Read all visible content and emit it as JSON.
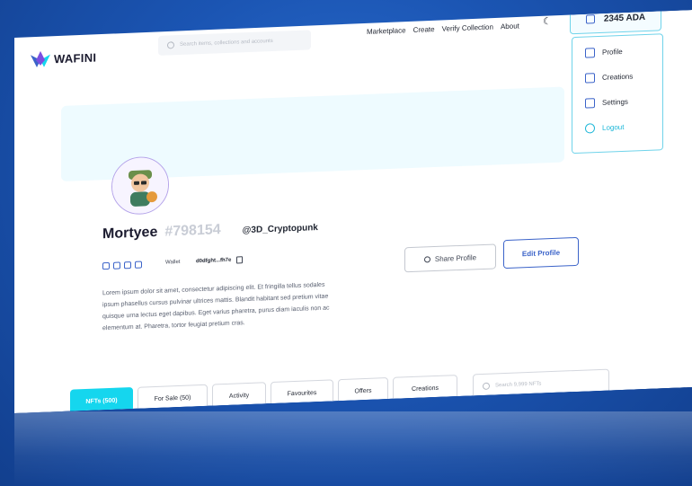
{
  "brand": {
    "logo_text": "WAFINI"
  },
  "header": {
    "search_placeholder": "Search items, collections and accounts",
    "nav": [
      "Marketplace",
      "Create",
      "Verify Collection",
      "About"
    ],
    "wallet_balance": "2345 ADA"
  },
  "dropdown": {
    "items": [
      {
        "label": "Profile",
        "icon": "profile-icon"
      },
      {
        "label": "Creations",
        "icon": "palette-icon"
      },
      {
        "label": "Settings",
        "icon": "gear-icon"
      },
      {
        "label": "Logout",
        "icon": "logout-icon"
      }
    ]
  },
  "profile": {
    "name": "Mortyee",
    "id_tag": "#798154",
    "handle": "@3D_Cryptopunk",
    "wallet_label": "Wallet",
    "wallet_address": "d0dfght...fh7e",
    "bio": "Lorem ipsum dolor sit amet, consectetur adipiscing elit. Et fringilla tellus sodales ipsum phasellus cursus pulvinar ultrices mattis. Blandit habitant sed pretium vitae quisque urna lectus eget dapibus. Eget varius pharetra, purus diam iaculis non ac elementum at. Pharetra, tortor feugiat pretium cras.",
    "share_label": "Share Profile",
    "edit_label": "Edit Profile"
  },
  "tabs": [
    "NFTs (500)",
    "For Sale (50)",
    "Activity",
    "Favourites",
    "Offers",
    "Creations"
  ],
  "nft_search_placeholder": "Search 9,999 NFTs",
  "colors": {
    "accent": "#15d6ee",
    "primary": "#3b63c9",
    "background": "#1b55b3"
  }
}
